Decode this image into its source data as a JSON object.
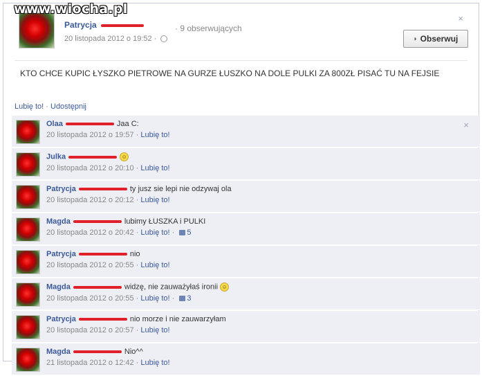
{
  "watermark": "www.wiocha.pl",
  "post": {
    "author": "Patrycja",
    "followers": "9 obserwujących",
    "date": "20 listopada 2012 o 19:52",
    "meta_sep": "·",
    "follow_label": "Obserwuj",
    "follow_icon": "rss-icon",
    "text": "KTO CHCE KUPIC ŁYSZKO PIETROWE NA GURZE ŁUSZKO NA DOLE PULKI ZA 800ZŁ PISAĆ TU NA FEJSIE",
    "actions": {
      "like": "Lubię to!",
      "sep": "·",
      "share": "Udostępnij"
    },
    "close": "×"
  },
  "comments": [
    {
      "name": "Olaa",
      "text": "Jaa C:",
      "smiley": false,
      "date": "20 listopada 2012 o 19:57",
      "like": "Lubię to!",
      "likes": "",
      "close": "×"
    },
    {
      "name": "Julka",
      "text": "",
      "smiley": true,
      "date": "20 listopada 2012 o 20:10",
      "like": "Lubię to!",
      "likes": ""
    },
    {
      "name": "Patrycja",
      "text": "ty jusz sie lepi nie odzywaj ola",
      "smiley": false,
      "date": "20 listopada 2012 o 20:12",
      "like": "Lubię to!",
      "likes": ""
    },
    {
      "name": "Magda",
      "text": "lubimy ŁUSZKA i PULKI",
      "smiley": false,
      "date": "20 listopada 2012 o 20:42",
      "like": "Lubię to!",
      "likes": "5"
    },
    {
      "name": "Patrycja",
      "text": "nio",
      "smiley": false,
      "date": "20 listopada 2012 o 20:55",
      "like": "Lubię to!",
      "likes": ""
    },
    {
      "name": "Magda",
      "text": "widzę, nie zauważyłaś ironii",
      "smiley": true,
      "date": "20 listopada 2012 o 20:55",
      "like": "Lubię to!",
      "likes": "3"
    },
    {
      "name": "Patrycja",
      "text": "nio morze i nie zauwarzyłam",
      "smiley": false,
      "date": "20 listopada 2012 o 20:57",
      "like": "Lubię to!",
      "likes": ""
    },
    {
      "name": "Magda",
      "text": "Nio^^",
      "smiley": false,
      "date": "21 listopada 2012 o 12:42",
      "like": "Lubię to!",
      "likes": ""
    }
  ],
  "colors": {
    "link": "#3b5998",
    "comment_bg": "#edeff4",
    "redaction": "#e0202a"
  }
}
